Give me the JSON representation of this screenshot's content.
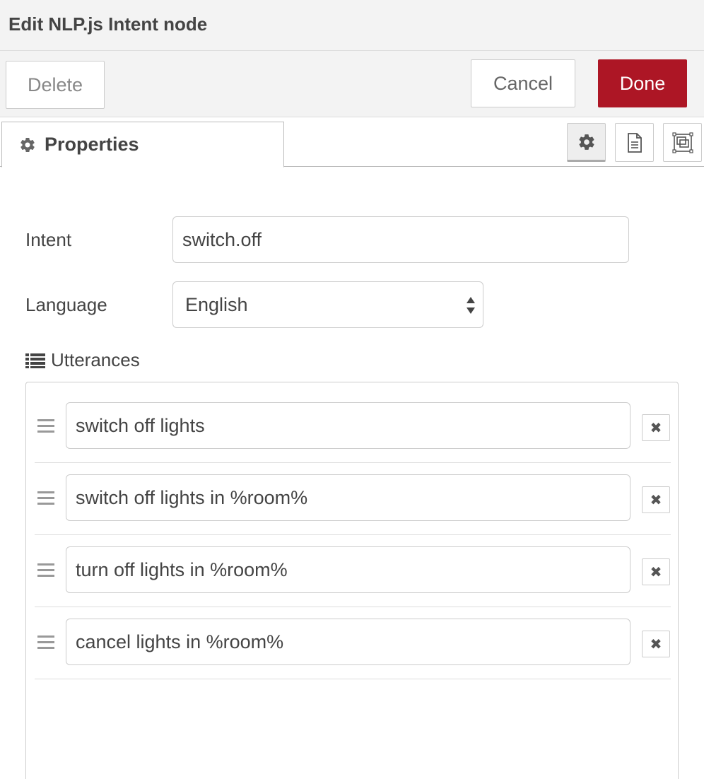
{
  "dialog": {
    "title": "Edit NLP.js Intent node"
  },
  "toolbar": {
    "delete_label": "Delete",
    "cancel_label": "Cancel",
    "done_label": "Done",
    "done_color": "#ad1625"
  },
  "tabs": {
    "properties_label": "Properties",
    "icons": [
      "gear-icon",
      "description-icon",
      "appearance-icon"
    ]
  },
  "form": {
    "intent_label": "Intent",
    "intent_value": "switch.off",
    "language_label": "Language",
    "language_value": "English"
  },
  "utterances": {
    "label": "Utterances",
    "items": [
      {
        "value": "switch off lights"
      },
      {
        "value": "switch off lights in %room%"
      },
      {
        "value": "turn off lights in %room%"
      },
      {
        "value": "cancel lights in %room%"
      }
    ],
    "remove_glyph": "✖"
  }
}
